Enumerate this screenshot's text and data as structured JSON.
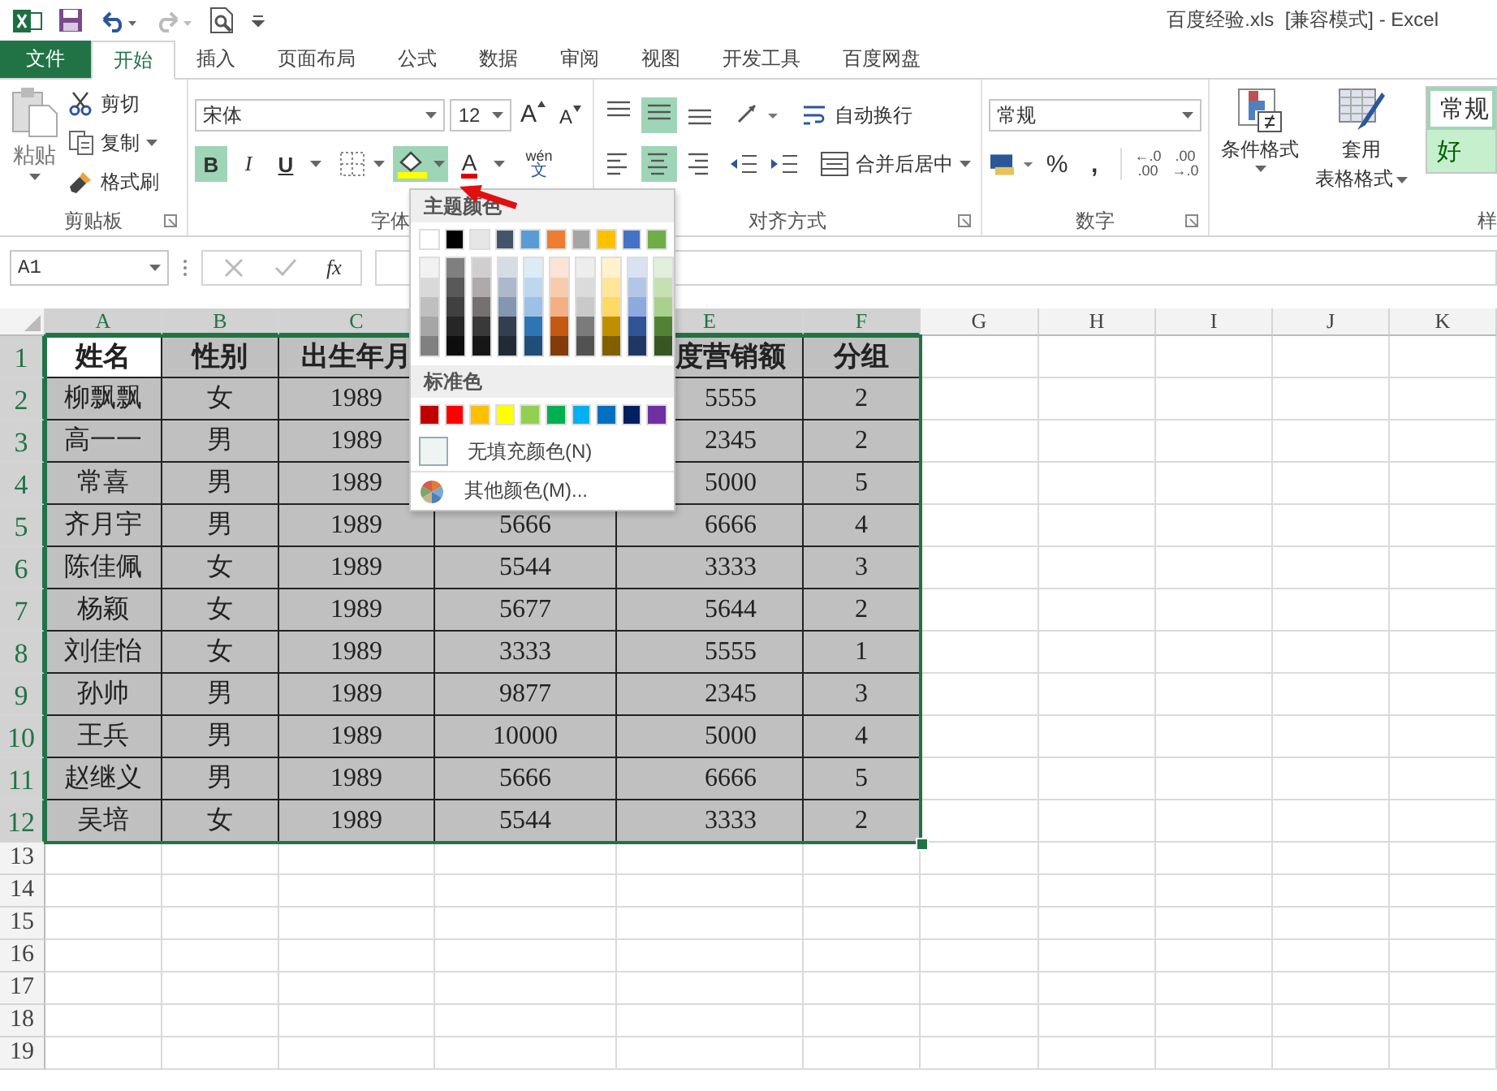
{
  "title_bar": {
    "title": "百度经验.xls  [兼容模式] - Excel"
  },
  "tabs": [
    {
      "label": "文件",
      "kind": "file",
      "selected": false
    },
    {
      "label": "开始",
      "kind": "tab",
      "selected": true
    },
    {
      "label": "插入",
      "kind": "tab",
      "selected": false
    },
    {
      "label": "页面布局",
      "kind": "tab",
      "selected": false
    },
    {
      "label": "公式",
      "kind": "tab",
      "selected": false
    },
    {
      "label": "数据",
      "kind": "tab",
      "selected": false
    },
    {
      "label": "审阅",
      "kind": "tab",
      "selected": false
    },
    {
      "label": "视图",
      "kind": "tab",
      "selected": false
    },
    {
      "label": "开发工具",
      "kind": "tab",
      "selected": false
    },
    {
      "label": "百度网盘",
      "kind": "tab",
      "selected": false
    }
  ],
  "ribbon": {
    "clipboard": {
      "label": "剪贴板",
      "paste": "粘贴",
      "actions": [
        {
          "kind": "cut",
          "label": "剪切"
        },
        {
          "kind": "copy",
          "label": "复制"
        },
        {
          "kind": "painter",
          "label": "格式刷"
        }
      ]
    },
    "font": {
      "label": "字体",
      "font_name": "宋体",
      "font_size": "12",
      "grow": "A",
      "shrink": "A",
      "buttons": [
        {
          "kind": "bold",
          "label": "B",
          "selected": true
        },
        {
          "kind": "italic",
          "label": "I",
          "selected": false
        },
        {
          "kind": "underline",
          "label": "U",
          "selected": false
        }
      ],
      "fill_open": true,
      "font_color": "A",
      "pinyin": "wén",
      "pinyin_glyph": "文"
    },
    "alignment": {
      "label": "对齐方式",
      "vertical": [
        {
          "kind": "top",
          "selected": false
        },
        {
          "kind": "middle",
          "selected": true
        },
        {
          "kind": "bottom",
          "selected": false
        }
      ],
      "horizontal": [
        {
          "kind": "left",
          "selected": false
        },
        {
          "kind": "center",
          "selected": true
        },
        {
          "kind": "right",
          "selected": false
        }
      ],
      "wrap": "自动换行",
      "merge": "合并后居中"
    },
    "number": {
      "label": "数字",
      "format": "常规",
      "percent": "%",
      "comma": ",",
      "increase_decimal": [
        "←.0",
        ".00"
      ],
      "decrease_decimal": [
        ".00",
        "→.0"
      ]
    },
    "styles": {
      "conditional": "条件格式",
      "table_format": [
        "套用",
        "表格格式"
      ],
      "cells": [
        {
          "kind": "normal",
          "label": "常规"
        },
        {
          "kind": "good",
          "label": "好"
        }
      ],
      "label": "样"
    }
  },
  "formula_bar": {
    "name_box": "A1",
    "fx": "fx"
  },
  "fill_menu": {
    "theme_label": "主题颜色",
    "theme": [
      {
        "color": "#ffffff",
        "shades": [
          {
            "color": "#f2f2f2"
          },
          {
            "color": "#d9d9d9"
          },
          {
            "color": "#bfbfbf"
          },
          {
            "color": "#a6a6a6"
          },
          {
            "color": "#808080"
          }
        ]
      },
      {
        "color": "#000000",
        "shades": [
          {
            "color": "#7f7f7f"
          },
          {
            "color": "#595959"
          },
          {
            "color": "#404040"
          },
          {
            "color": "#262626"
          },
          {
            "color": "#0d0d0d"
          }
        ]
      },
      {
        "color": "#e7e6e6",
        "shades": [
          {
            "color": "#d0cece"
          },
          {
            "color": "#aeaaaa"
          },
          {
            "color": "#757171"
          },
          {
            "color": "#3a3838"
          },
          {
            "color": "#161616"
          }
        ]
      },
      {
        "color": "#44546a",
        "shades": [
          {
            "color": "#d6dce4"
          },
          {
            "color": "#adb9ca"
          },
          {
            "color": "#8497b0"
          },
          {
            "color": "#333f4f"
          },
          {
            "color": "#222b35"
          }
        ]
      },
      {
        "color": "#5b9bd5",
        "shades": [
          {
            "color": "#ddebf7"
          },
          {
            "color": "#bdd7ee"
          },
          {
            "color": "#9bc2e6"
          },
          {
            "color": "#2f75b5"
          },
          {
            "color": "#1f4e78"
          }
        ]
      },
      {
        "color": "#ed7d31",
        "shades": [
          {
            "color": "#fce4d6"
          },
          {
            "color": "#f8cbad"
          },
          {
            "color": "#f4b084"
          },
          {
            "color": "#c65911"
          },
          {
            "color": "#833c0c"
          }
        ]
      },
      {
        "color": "#a5a5a5",
        "shades": [
          {
            "color": "#ededed"
          },
          {
            "color": "#dbdbdb"
          },
          {
            "color": "#c9c9c9"
          },
          {
            "color": "#7b7b7b"
          },
          {
            "color": "#525252"
          }
        ]
      },
      {
        "color": "#ffc000",
        "shades": [
          {
            "color": "#fff2cc"
          },
          {
            "color": "#ffe699"
          },
          {
            "color": "#ffd966"
          },
          {
            "color": "#bf8f00"
          },
          {
            "color": "#806000"
          }
        ]
      },
      {
        "color": "#4472c4",
        "shades": [
          {
            "color": "#d9e1f2"
          },
          {
            "color": "#b4c6e7"
          },
          {
            "color": "#8ea9db"
          },
          {
            "color": "#305496"
          },
          {
            "color": "#203764"
          }
        ]
      },
      {
        "color": "#70ad47",
        "shades": [
          {
            "color": "#e2efda"
          },
          {
            "color": "#c6e0b4"
          },
          {
            "color": "#a9d08e"
          },
          {
            "color": "#548235"
          },
          {
            "color": "#375623"
          }
        ]
      }
    ],
    "standard_label": "标准色",
    "standard": [
      {
        "color": "#c00000"
      },
      {
        "color": "#ff0000"
      },
      {
        "color": "#ffc000"
      },
      {
        "color": "#ffff00"
      },
      {
        "color": "#92d050"
      },
      {
        "color": "#00b050"
      },
      {
        "color": "#00b0f0"
      },
      {
        "color": "#0070c0"
      },
      {
        "color": "#002060"
      },
      {
        "color": "#7030a0"
      }
    ],
    "no_fill": "无填充颜色(N)",
    "more": "其他颜色(M)..."
  },
  "sheet": {
    "columns": [
      "A",
      "B",
      "C",
      null,
      "E",
      "F",
      "G",
      "H",
      "I",
      "J",
      "K"
    ],
    "rows": [
      {
        "header": "1",
        "cells": [
          "姓名",
          "性别",
          "出生年月",
          null,
          "度营销额",
          "分组"
        ]
      },
      {
        "header": "2",
        "cells": [
          "柳飘飘",
          "女",
          "1989",
          null,
          "5555",
          "2"
        ]
      },
      {
        "header": "3",
        "cells": [
          "高一一",
          "男",
          "1989",
          null,
          "2345",
          "2"
        ]
      },
      {
        "header": "4",
        "cells": [
          "常喜",
          "男",
          "1989",
          null,
          "5000",
          "5"
        ]
      },
      {
        "header": "5",
        "cells": [
          "齐月宇",
          "男",
          "1989",
          "5666",
          "6666",
          "4"
        ]
      },
      {
        "header": "6",
        "cells": [
          "陈佳佩",
          "女",
          "1989",
          "5544",
          "3333",
          "3"
        ]
      },
      {
        "header": "7",
        "cells": [
          "杨颖",
          "女",
          "1989",
          "5677",
          "5644",
          "2"
        ]
      },
      {
        "header": "8",
        "cells": [
          "刘佳怡",
          "女",
          "1989",
          "3333",
          "5555",
          "1"
        ]
      },
      {
        "header": "9",
        "cells": [
          "孙帅",
          "男",
          "1989",
          "9877",
          "2345",
          "3"
        ]
      },
      {
        "header": "10",
        "cells": [
          "王兵",
          "男",
          "1989",
          "10000",
          "5000",
          "4"
        ]
      },
      {
        "header": "11",
        "cells": [
          "赵继义",
          "男",
          "1989",
          "5666",
          "6666",
          "5"
        ]
      },
      {
        "header": "12",
        "cells": [
          "吴培",
          "女",
          "1989",
          "5544",
          "3333",
          "2"
        ]
      }
    ],
    "empty_rows": [
      "13",
      "14",
      "15",
      "16",
      "17",
      "18",
      "19"
    ]
  }
}
